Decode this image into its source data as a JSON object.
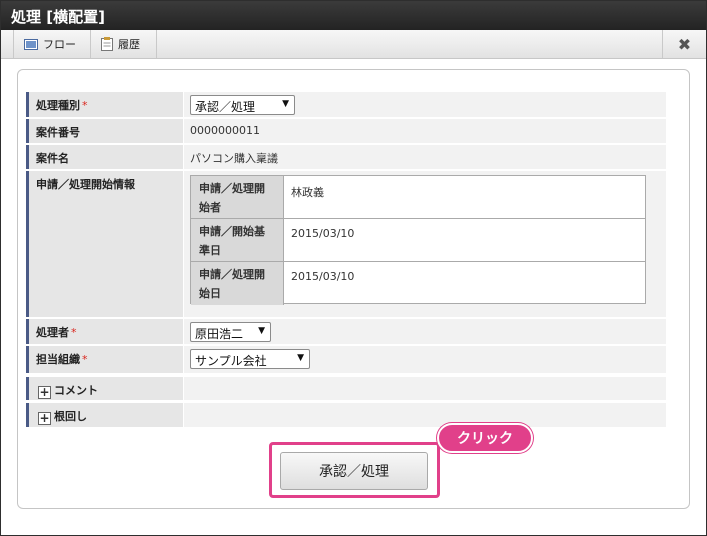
{
  "window": {
    "title": "処理 [横配置]"
  },
  "toolbar": {
    "flow_label": "フロー",
    "history_label": "履歴"
  },
  "form": {
    "process_type": {
      "label": "処理種別",
      "required": "*",
      "value": "承認／処理"
    },
    "case_number": {
      "label": "案件番号",
      "value": "0000000011"
    },
    "case_name": {
      "label": "案件名",
      "value": "パソコン購入稟議"
    },
    "start_info": {
      "label": "申請／処理開始情報",
      "rows": [
        {
          "label1": "申請／処理開",
          "label2": "始者",
          "value": "林政義"
        },
        {
          "label1": "申請／開始基",
          "label2": "準日",
          "value": "2015/03/10"
        },
        {
          "label1": "申請／処理開",
          "label2": "始日",
          "value": "2015/03/10"
        }
      ]
    },
    "processor": {
      "label": "処理者",
      "required": "*",
      "value": "原田浩二"
    },
    "organization": {
      "label": "担当組織",
      "required": "*",
      "value": "サンプル会社"
    },
    "comment": {
      "label": "コメント"
    },
    "nemawashi": {
      "label": "根回し"
    }
  },
  "actions": {
    "approve_label": "承認／処理"
  },
  "callout": {
    "text": "クリック"
  },
  "colors": {
    "accent": "#e1408a",
    "label_border": "#4a5a86",
    "required": "#d9251d"
  }
}
